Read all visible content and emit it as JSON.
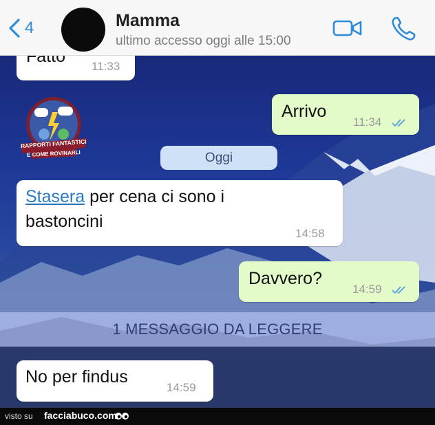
{
  "header": {
    "back_count": "4",
    "contact_name": "Mamma",
    "last_seen": "ultimo accesso oggi alle 15:00"
  },
  "chat": {
    "logo_text": [
      "RAPPORTI FANTASTICI",
      "E COME ROVINARLI"
    ],
    "day_separator": "Oggi",
    "unread_banner": "1 MESSAGGIO DA LEGGERE",
    "messages": [
      {
        "direction": "incoming",
        "text": "Fatto",
        "time": "11:33"
      },
      {
        "direction": "outgoing",
        "text": "Arrivo",
        "time": "11:34",
        "read": true
      },
      {
        "direction": "incoming",
        "link_word": "Stasera",
        "text_rest": " per cena ci sono i",
        "text_line2": "bastoncini",
        "time": "14:58"
      },
      {
        "direction": "outgoing",
        "text": "Davvero?",
        "time": "14:59",
        "read": true
      },
      {
        "direction": "incoming",
        "text": "No per findus",
        "time": "14:59"
      }
    ]
  },
  "footer": {
    "prefix": "visto su",
    "site": "facciabuco.com"
  },
  "colors": {
    "accent": "#2d8bd8",
    "outgoing_bubble": "#e2fbc8",
    "read_ticks": "#4fa3e0"
  }
}
